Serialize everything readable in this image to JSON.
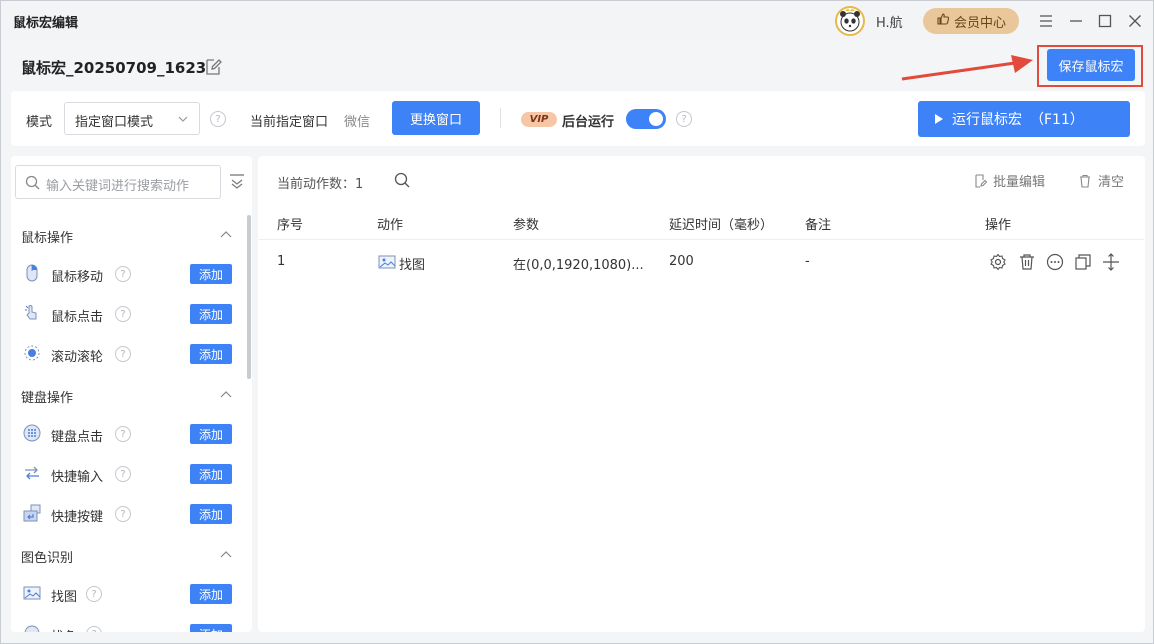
{
  "titlebar": {
    "app_title": "鼠标宏编辑",
    "username": "H.航",
    "vip_center": "会员中心"
  },
  "header": {
    "macro_name": "鼠标宏_20250709_1623",
    "save_label": "保存鼠标宏"
  },
  "toolbar": {
    "mode_label": "模式",
    "mode_value": "指定窗口模式",
    "current_window_label": "当前指定窗口",
    "current_window_value": "微信",
    "change_window_label": "更换窗口",
    "vip_badge": "VIP",
    "background_run_label": "后台运行",
    "background_run_on": true,
    "run_label": "运行鼠标宏",
    "run_hotkey": "（F11）"
  },
  "sidebar": {
    "search_placeholder": "输入关键词进行搜索动作",
    "add_label": "添加",
    "groups": [
      {
        "title": "鼠标操作",
        "items": [
          "鼠标移动",
          "鼠标点击",
          "滚动滚轮"
        ]
      },
      {
        "title": "键盘操作",
        "items": [
          "键盘点击",
          "快捷输入",
          "快捷按键"
        ]
      },
      {
        "title": "图色识别",
        "items": [
          "找图",
          "找色"
        ]
      }
    ]
  },
  "main": {
    "count_label": "当前动作数：1",
    "batch_edit": "批量编辑",
    "clear": "清空",
    "columns": [
      "序号",
      "动作",
      "参数",
      "延迟时间（毫秒）",
      "备注",
      "操作"
    ],
    "rows": [
      {
        "index": "1",
        "action": "找图",
        "params": "在(0,0,1920,1080)...",
        "delay": "200",
        "note": "-"
      }
    ]
  },
  "colors": {
    "accent": "#3e82f7",
    "highlight_border": "#e24a3b",
    "vip_gold": "#e9c79a"
  }
}
